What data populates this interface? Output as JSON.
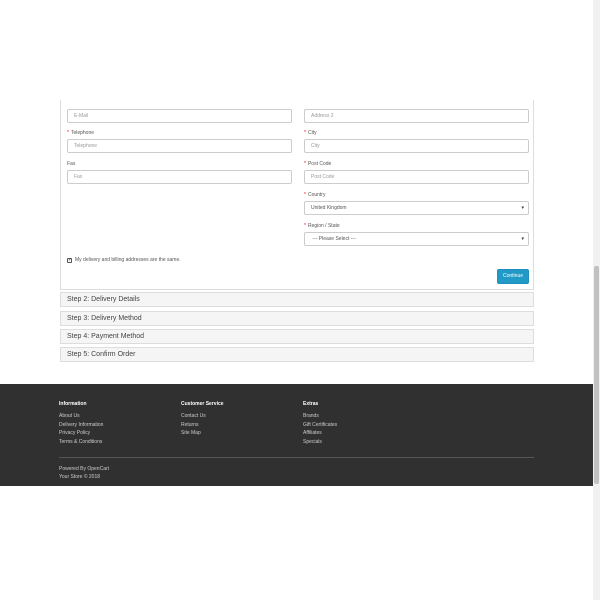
{
  "form": {
    "email": {
      "placeholder": "E-Mail"
    },
    "address2": {
      "placeholder": "Address 2"
    },
    "telephone": {
      "label": "Telephone",
      "placeholder": "Telephone"
    },
    "city": {
      "label": "City",
      "placeholder": "City"
    },
    "fax": {
      "label": "Fax",
      "placeholder": "Fax"
    },
    "postcode": {
      "label": "Post Code",
      "placeholder": "Post Code"
    },
    "country": {
      "label": "Country",
      "value": "United Kingdom"
    },
    "region": {
      "label": "Region / State",
      "value": " --- Please Select --- "
    },
    "required_marker": "*",
    "same_address_label": "My delivery and billing addresses are the same.",
    "same_address_checked": true,
    "continue_label": "Continue"
  },
  "steps": [
    {
      "label": "Step 2: Delivery Details"
    },
    {
      "label": "Step 3: Delivery Method"
    },
    {
      "label": "Step 4: Payment Method"
    },
    {
      "label": "Step 5: Confirm Order"
    }
  ],
  "footer": {
    "information": {
      "heading": "Information",
      "links": [
        "About Us",
        "Delivery Information",
        "Privacy Policy",
        "Terms & Conditions"
      ]
    },
    "customer_service": {
      "heading": "Customer Service",
      "links": [
        "Contact Us",
        "Returns",
        "Site Map"
      ]
    },
    "extras": {
      "heading": "Extras",
      "links": [
        "Brands",
        "Gift Certificates",
        "Affiliates",
        "Specials"
      ]
    },
    "powered_by": "Powered By OpenCart",
    "copyright": "Your Store © 2018"
  },
  "colors": {
    "accent": "#229ac8",
    "footer_bg": "#303030",
    "required": "#ff0000"
  }
}
